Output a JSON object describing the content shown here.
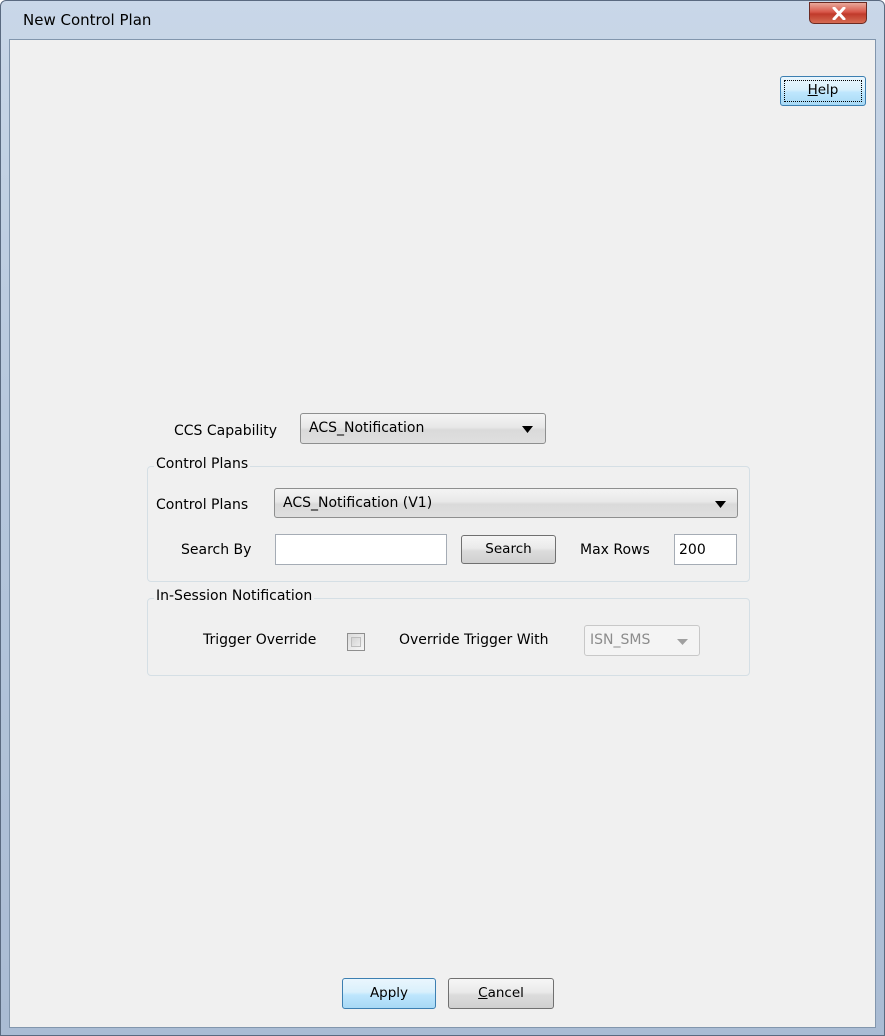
{
  "window": {
    "title": "New Control Plan",
    "close_icon": "close-icon"
  },
  "header": {
    "help_label_underlined": "H",
    "help_label_rest": "elp"
  },
  "capability": {
    "label": "CCS Capability",
    "selected": "ACS_Notification"
  },
  "control_plans_group": {
    "title": "Control Plans",
    "control_plans_label": "Control Plans",
    "control_plans_selected": "ACS_Notification (V1)",
    "search_by_label": "Search By",
    "search_by_value": "",
    "search_button": "Search",
    "max_rows_label": "Max Rows",
    "max_rows_value": "200"
  },
  "isn_group": {
    "title": "In-Session Notification",
    "trigger_override_label": "Trigger Override",
    "trigger_override_checked": false,
    "override_trigger_with_label": "Override Trigger With",
    "override_trigger_with_selected": "ISN_SMS"
  },
  "footer": {
    "apply_label": "Apply",
    "cancel_label_underlined": "C",
    "cancel_label_rest": "ancel"
  }
}
